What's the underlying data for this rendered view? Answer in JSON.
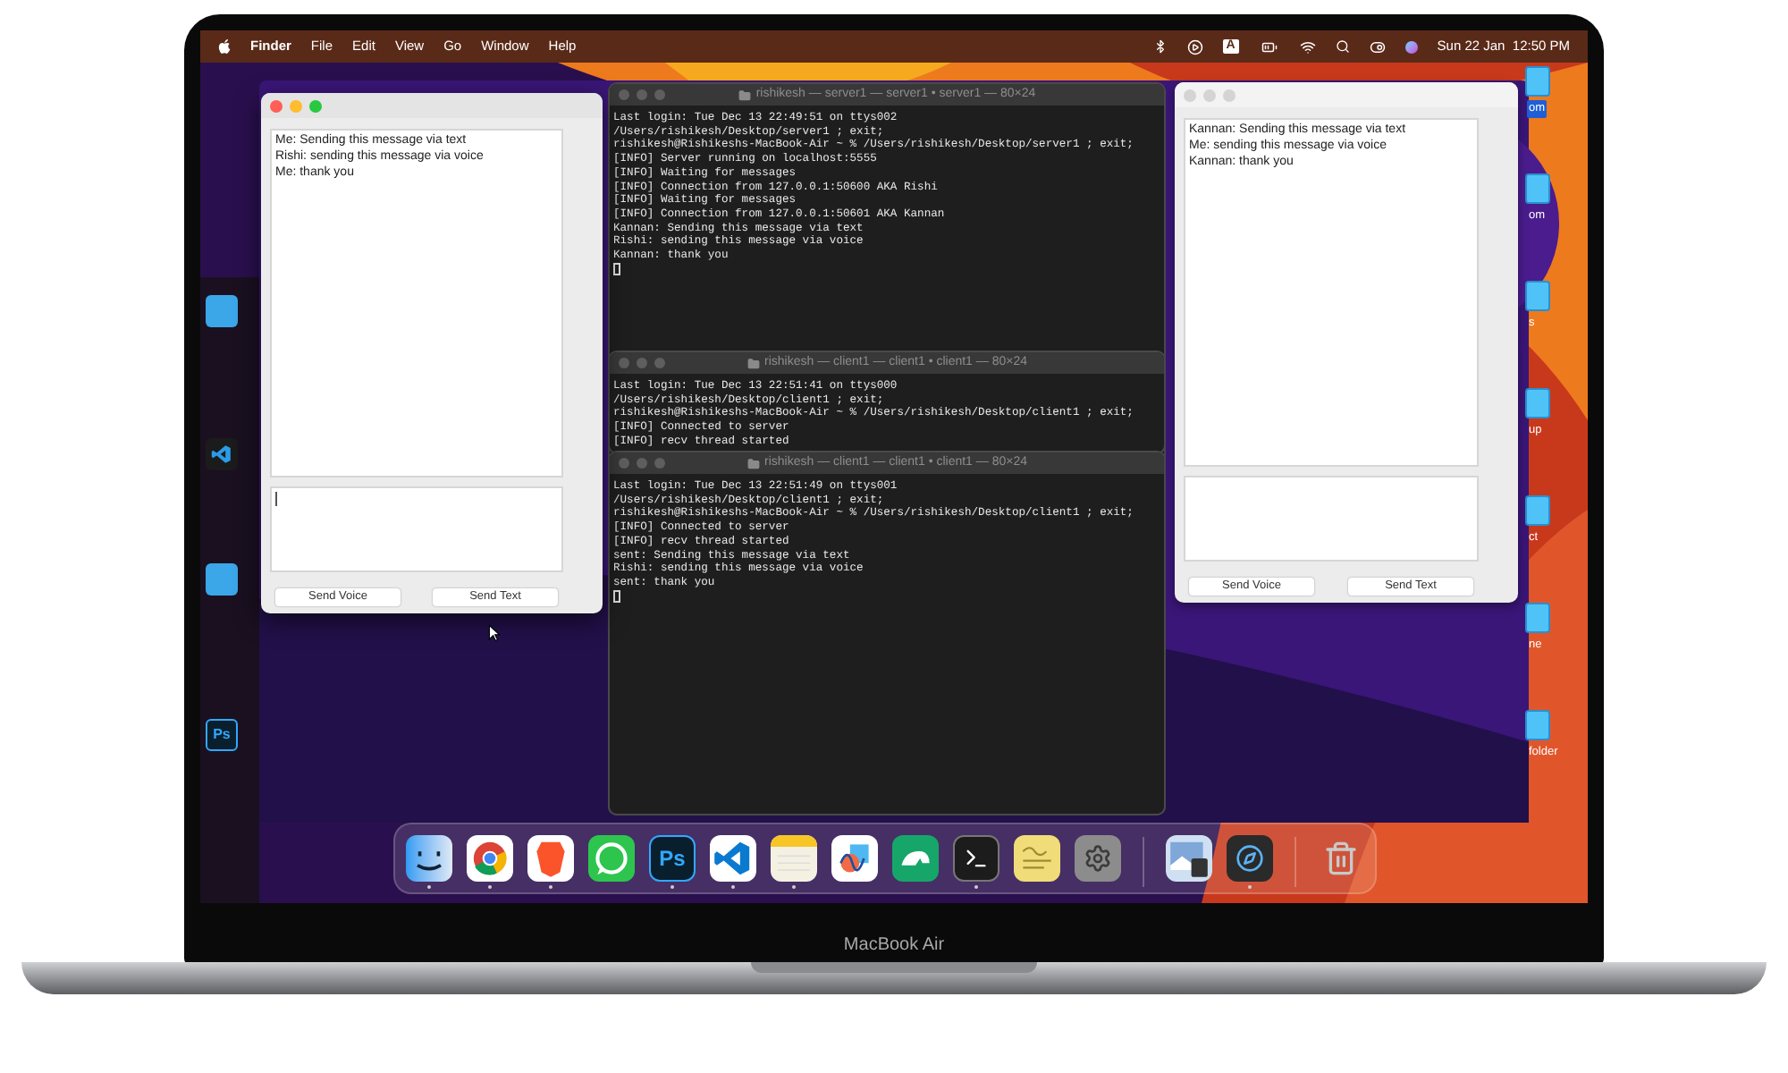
{
  "menubar": {
    "app": "Finder",
    "menus": [
      "File",
      "Edit",
      "View",
      "Go",
      "Window",
      "Help"
    ],
    "input_source": "A",
    "clock": "Sun 22 Jan  12:50 PM"
  },
  "chat_windows": [
    {
      "focused": true,
      "messages": [
        "Me: Sending this message via text",
        "Rishi: sending this message via voice",
        "Me: thank you"
      ],
      "input_cursor": true,
      "buttons": [
        "Send Voice",
        "Send Text"
      ]
    },
    {
      "focused": false,
      "messages": [
        "Kannan: Sending this message via text",
        "Me: sending this message via voice",
        "Kannan: thank you"
      ],
      "input_cursor": false,
      "buttons": [
        "Send Voice",
        "Send Text"
      ]
    }
  ],
  "terminals": [
    {
      "title": "rishikesh — server1 — server1 • server1 — 80×24",
      "lines": [
        "Last login: Tue Dec 13 22:49:51 on ttys002",
        "/Users/rishikesh/Desktop/server1 ; exit;",
        "rishikesh@Rishikeshs-MacBook-Air ~ % /Users/rishikesh/Desktop/server1 ; exit;",
        "[INFO] Server running on localhost:5555",
        "[INFO] Waiting for messages",
        "[INFO] Connection from 127.0.0.1:50600 AKA Rishi",
        "[INFO] Waiting for messages",
        "[INFO] Connection from 127.0.0.1:50601 AKA Kannan",
        "Kannan: Sending this message via text",
        "Rishi: sending this message via voice",
        "Kannan: thank you"
      ],
      "cursor": true
    },
    {
      "title": "rishikesh — client1 — client1 • client1 — 80×24",
      "lines": [
        "Last login: Tue Dec 13 22:51:41 on ttys000",
        "/Users/rishikesh/Desktop/client1 ; exit;",
        "rishikesh@Rishikeshs-MacBook-Air ~ % /Users/rishikesh/Desktop/client1 ; exit;",
        "[INFO] Connected to server",
        "[INFO] recv thread started"
      ],
      "cursor": false
    },
    {
      "title": "rishikesh — client1 — client1 • client1 — 80×24",
      "lines": [
        "Last login: Tue Dec 13 22:51:49 on ttys001",
        "/Users/rishikesh/Desktop/client1 ; exit;",
        "rishikesh@Rishikeshs-MacBook-Air ~ % /Users/rishikesh/Desktop/client1 ; exit;",
        "[INFO] Connected to server",
        "[INFO] recv thread started",
        "sent: Sending this message via text",
        "Rishi: sending this message via voice",
        "sent: thank you"
      ],
      "cursor": true
    }
  ],
  "desktop_icons": [
    {
      "label": "om",
      "selected": true
    },
    {
      "label": "om",
      "selected": false
    },
    {
      "label": "s",
      "selected": false
    },
    {
      "label": "up",
      "selected": false
    },
    {
      "label": "ct",
      "selected": false
    },
    {
      "label": "ne",
      "selected": false
    },
    {
      "label": "folder",
      "selected": false
    }
  ],
  "side_icons": [
    {
      "kind": "folder"
    },
    {
      "kind": "code"
    },
    {
      "kind": "folder"
    },
    {
      "kind": "ps",
      "label": "Ps"
    }
  ],
  "dock": [
    {
      "kind": "finder",
      "running": true
    },
    {
      "kind": "chrome",
      "running": true
    },
    {
      "kind": "brave",
      "running": true
    },
    {
      "kind": "whatsapp",
      "running": false
    },
    {
      "kind": "photoshop",
      "label": "Ps",
      "running": true
    },
    {
      "kind": "vscode",
      "running": true
    },
    {
      "kind": "notes",
      "running": true
    },
    {
      "kind": "freeform",
      "running": false
    },
    {
      "kind": "mongo",
      "running": false
    },
    {
      "kind": "terminal",
      "running": true
    },
    {
      "kind": "stickies",
      "running": false
    },
    {
      "kind": "settings",
      "running": false
    },
    {
      "kind": "separator"
    },
    {
      "kind": "preview",
      "running": false
    },
    {
      "kind": "quicktime",
      "running": true
    },
    {
      "kind": "separator"
    },
    {
      "kind": "trash",
      "running": false
    }
  ],
  "device_label": "MacBook Air"
}
